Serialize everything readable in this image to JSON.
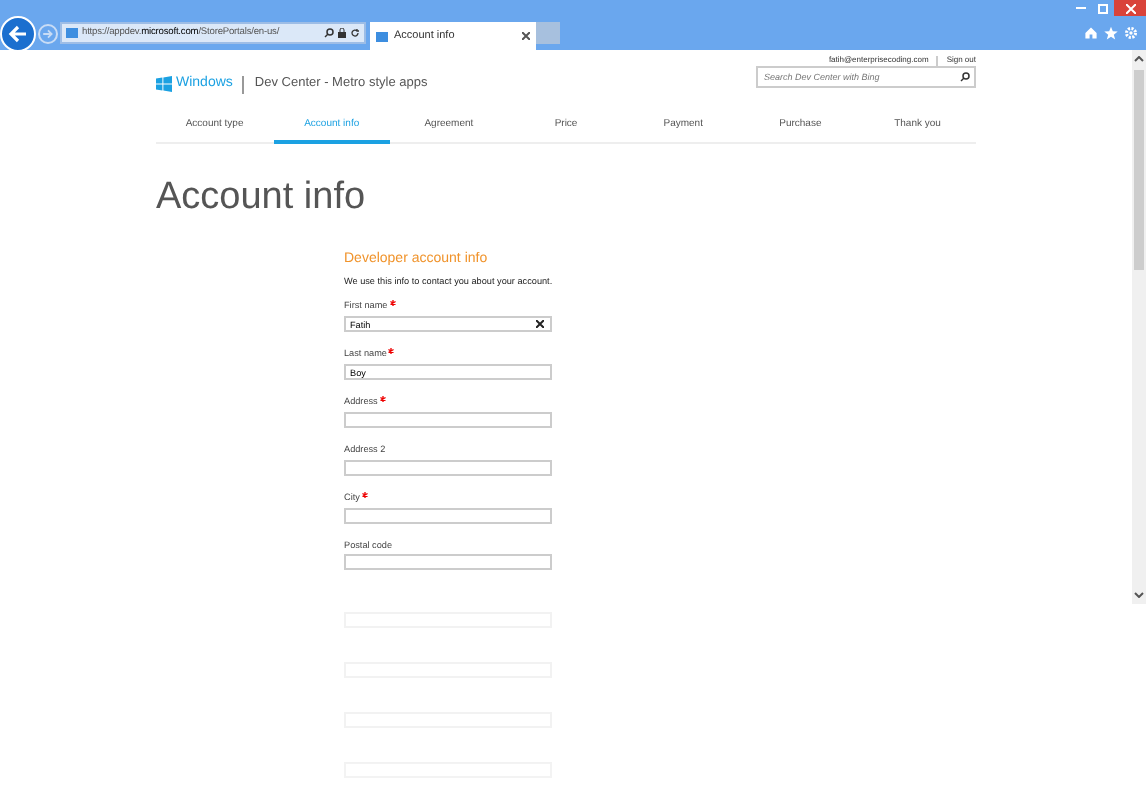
{
  "browser": {
    "address": "https://appdev.**microsoft.com**/StorePortals/en-us/",
    "tab_title": "Account info"
  },
  "header": {
    "email": "fatih@enterprisecoding.com",
    "sign_out": "Sign out",
    "brand": "Windows",
    "site_title": "Dev Center - Metro style apps",
    "search": {
      "placeholder": "Search Dev Center with Bing"
    }
  },
  "steps": [
    {
      "label": "Account type",
      "selected": false
    },
    {
      "label": "Account info",
      "selected": true
    },
    {
      "label": "Agreement",
      "selected": false
    },
    {
      "label": "Price",
      "selected": false
    },
    {
      "label": "Payment",
      "selected": false
    },
    {
      "label": "Purchase",
      "selected": false
    },
    {
      "label": "Thank you",
      "selected": false
    }
  ],
  "page_title": "Account info",
  "section": {
    "title": "Developer account info",
    "description": "We use this info to contact you about your account."
  },
  "fields": [
    {
      "label": "First name",
      "required": true,
      "value": "Fatih",
      "clearable": true
    },
    {
      "label": "Last name",
      "required": true,
      "value": "Boy"
    },
    {
      "label": "Address",
      "required": true
    },
    {
      "label": "Address 2",
      "required": false
    },
    {
      "label": "City",
      "required": true
    },
    {
      "label": "Postal code",
      "required": false
    }
  ]
}
